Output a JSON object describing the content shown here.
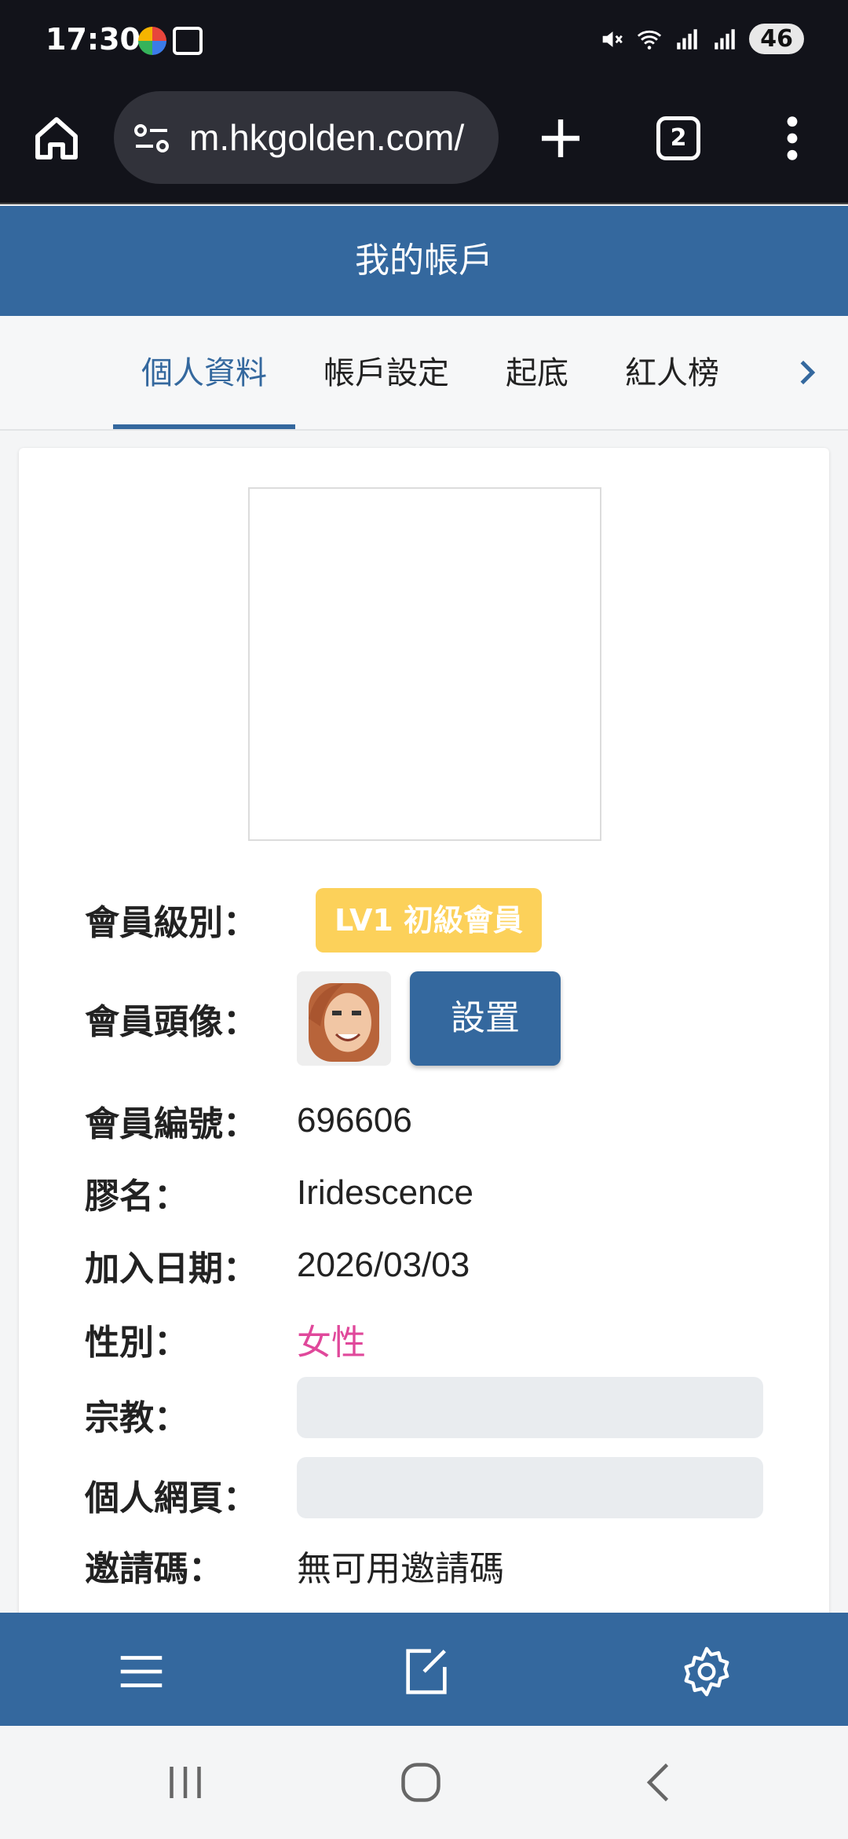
{
  "status_bar": {
    "time": "17:30",
    "battery": "46"
  },
  "browser": {
    "url": "m.hkgolden.com/",
    "tab_count": "2"
  },
  "header": {
    "title": "我的帳戶"
  },
  "tabs": [
    {
      "label": "個人資料",
      "active": true
    },
    {
      "label": "帳戶設定",
      "active": false
    },
    {
      "label": "起底",
      "active": false
    },
    {
      "label": "紅人榜",
      "active": false
    }
  ],
  "profile": {
    "level_label": "會員級別：",
    "level_badge": "LV1 初級會員",
    "avatar_label": "會員頭像：",
    "set_button": "設置",
    "member_id_label": "會員編號：",
    "member_id": "696606",
    "nickname_label": "膠名：",
    "nickname": "Iridescence",
    "join_date_label": "加入日期：",
    "join_date": "2026/03/03",
    "gender_label": "性別：",
    "gender": "女性",
    "religion_label": "宗教：",
    "religion": "",
    "homepage_label": "個人網頁：",
    "homepage": "",
    "invite_label": "邀請碼：",
    "invite_value": "無可用邀請碼"
  },
  "colors": {
    "primary": "#34689e",
    "badge": "#fcd15a",
    "female": "#e0489b"
  },
  "icons": [
    "home-icon",
    "site-settings-icon",
    "plus-icon",
    "more-vert-icon",
    "chevron-right-icon",
    "menu-icon",
    "compose-icon",
    "settings-gear-icon",
    "recents-icon",
    "home-circle-icon",
    "back-icon"
  ]
}
